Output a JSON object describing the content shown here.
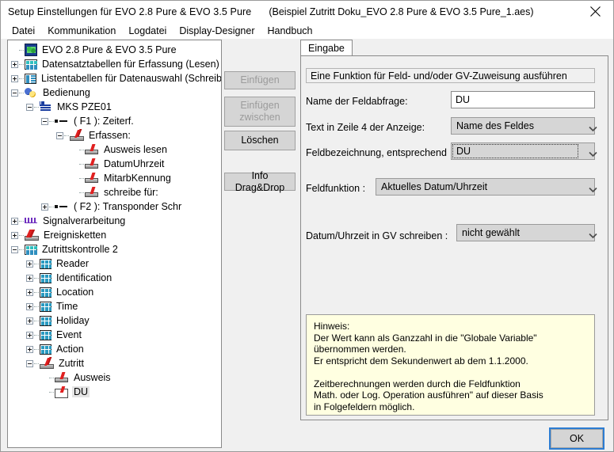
{
  "window": {
    "title": "Setup Einstellungen für EVO 2.8 Pure & EVO 3.5 Pure",
    "subtitle": "(Beispiel Zutritt Doku_EVO 2.8 Pure & EVO 3.5 Pure_1.aes)",
    "close_label": "✕"
  },
  "menu": {
    "items": [
      {
        "label": "Datei"
      },
      {
        "label": "Kommunikation"
      },
      {
        "label": "Logdatei"
      },
      {
        "label": "Display-Designer"
      },
      {
        "label": "Handbuch"
      }
    ]
  },
  "tree": {
    "nodes": [
      {
        "label": "EVO 2.8 Pure & EVO 3.5 Pure",
        "depth": 0,
        "expander": "none",
        "icon": "root-icon",
        "selected": false
      },
      {
        "label": "Datensatztabellen für Erfassung (Lesen)",
        "depth": 0,
        "expander": "plus",
        "icon": "grid-table-icon",
        "selected": false
      },
      {
        "label": "Listentabellen für Datenauswahl (Schreiben)",
        "depth": 0,
        "expander": "plus",
        "icon": "list-table-icon",
        "selected": false
      },
      {
        "label": "Bedienung",
        "depth": 0,
        "expander": "minus",
        "icon": "bedienung-icon",
        "selected": false
      },
      {
        "label": "MKS PZE01",
        "depth": 1,
        "expander": "minus",
        "icon": "mks-icon",
        "selected": false
      },
      {
        "label": "( F1 ): Zeiterf.",
        "depth": 2,
        "expander": "minus",
        "icon": "function-icon",
        "selected": false
      },
      {
        "label": "Erfassen:",
        "depth": 3,
        "expander": "minus",
        "icon": "erfassen-icon",
        "selected": false
      },
      {
        "label": "Ausweis lesen",
        "depth": 4,
        "expander": "none",
        "icon": "leaf-icon",
        "selected": false
      },
      {
        "label": "DatumUhrzeit",
        "depth": 4,
        "expander": "none",
        "icon": "leaf-icon",
        "selected": false
      },
      {
        "label": "MitarbKennung",
        "depth": 4,
        "expander": "none",
        "icon": "leaf-icon",
        "selected": false
      },
      {
        "label": "schreibe für:",
        "depth": 4,
        "expander": "none",
        "icon": "leaf-icon",
        "selected": false
      },
      {
        "label": "( F2 ): Transponder Schr",
        "depth": 2,
        "expander": "plus",
        "icon": "function-icon",
        "selected": false
      },
      {
        "label": "Signalverarbeitung",
        "depth": 0,
        "expander": "plus",
        "icon": "signal-icon",
        "selected": false
      },
      {
        "label": "Ereignisketten",
        "depth": 0,
        "expander": "plus",
        "icon": "event-chain-icon",
        "selected": false
      },
      {
        "label": "Zutrittskontrolle 2",
        "depth": 0,
        "expander": "minus",
        "icon": "grid-table-icon",
        "selected": false
      },
      {
        "label": "Reader",
        "depth": 1,
        "expander": "plus",
        "icon": "table-icon",
        "selected": false
      },
      {
        "label": "Identification",
        "depth": 1,
        "expander": "plus",
        "icon": "table-icon",
        "selected": false
      },
      {
        "label": "Location",
        "depth": 1,
        "expander": "plus",
        "icon": "table-icon",
        "selected": false
      },
      {
        "label": "Time",
        "depth": 1,
        "expander": "plus",
        "icon": "table-icon",
        "selected": false
      },
      {
        "label": "Holiday",
        "depth": 1,
        "expander": "plus",
        "icon": "table-icon",
        "selected": false
      },
      {
        "label": "Event",
        "depth": 1,
        "expander": "plus",
        "icon": "table-icon",
        "selected": false
      },
      {
        "label": "Action",
        "depth": 1,
        "expander": "plus",
        "icon": "table-icon",
        "selected": false
      },
      {
        "label": "Zutritt",
        "depth": 1,
        "expander": "minus",
        "icon": "erfassen-icon",
        "selected": false
      },
      {
        "label": "Ausweis",
        "depth": 2,
        "expander": "none",
        "icon": "leaf-icon",
        "selected": false
      },
      {
        "label": "DU",
        "depth": 2,
        "expander": "none",
        "icon": "leaf-box-icon",
        "selected": true
      }
    ]
  },
  "buttons": {
    "einfuegen": {
      "label": "Einfügen",
      "enabled": false
    },
    "einfuegen_zwischen": {
      "label": "Einfügen\nzwischen",
      "enabled": false
    },
    "loeschen": {
      "label": "Löschen",
      "enabled": true
    },
    "info_dragdrop": {
      "label": "Info Drag&Drop",
      "enabled": true
    }
  },
  "tabs": [
    {
      "label": "Eingabe",
      "active": true
    }
  ],
  "form": {
    "info_strip": "Eine Funktion für Feld- und/oder GV-Zuweisung ausführen",
    "fields": [
      {
        "label": "Name der Feldabfrage:",
        "value": "DU",
        "type": "text"
      },
      {
        "label": "Text in Zeile 4 der Anzeige:",
        "value": "Name des Feldes",
        "type": "combo"
      },
      {
        "label": "Feldbezeichnung, entsprechend",
        "value": "DU",
        "type": "combo",
        "focused": true
      },
      {
        "label": "Feldfunktion :",
        "value": "Aktuelles Datum/Uhrzeit",
        "type": "combo"
      },
      {
        "label": "Datum/Uhrzeit in GV schreiben :",
        "value": "nicht gewählt",
        "type": "combo"
      }
    ],
    "hint": "Hinweis:\nDer Wert kann als Ganzzahl in die \"Globale Variable\"\nübernommen werden.\nEr entspricht dem Sekundenwert ab dem 1.1.2000.\n\nZeitberechnungen werden durch die Feldfunktion\nMath. oder Log. Operation ausführen\" auf dieser Basis\nin Folgefeldern möglich."
  },
  "footer": {
    "ok_label": "OK"
  },
  "colors": {
    "window_bg": "#f0f0f0",
    "panel_white": "#ffffff",
    "hint_bg": "#ffffe1",
    "focus_blue": "#2d7dd2",
    "button_face": "#d5d5d5"
  }
}
